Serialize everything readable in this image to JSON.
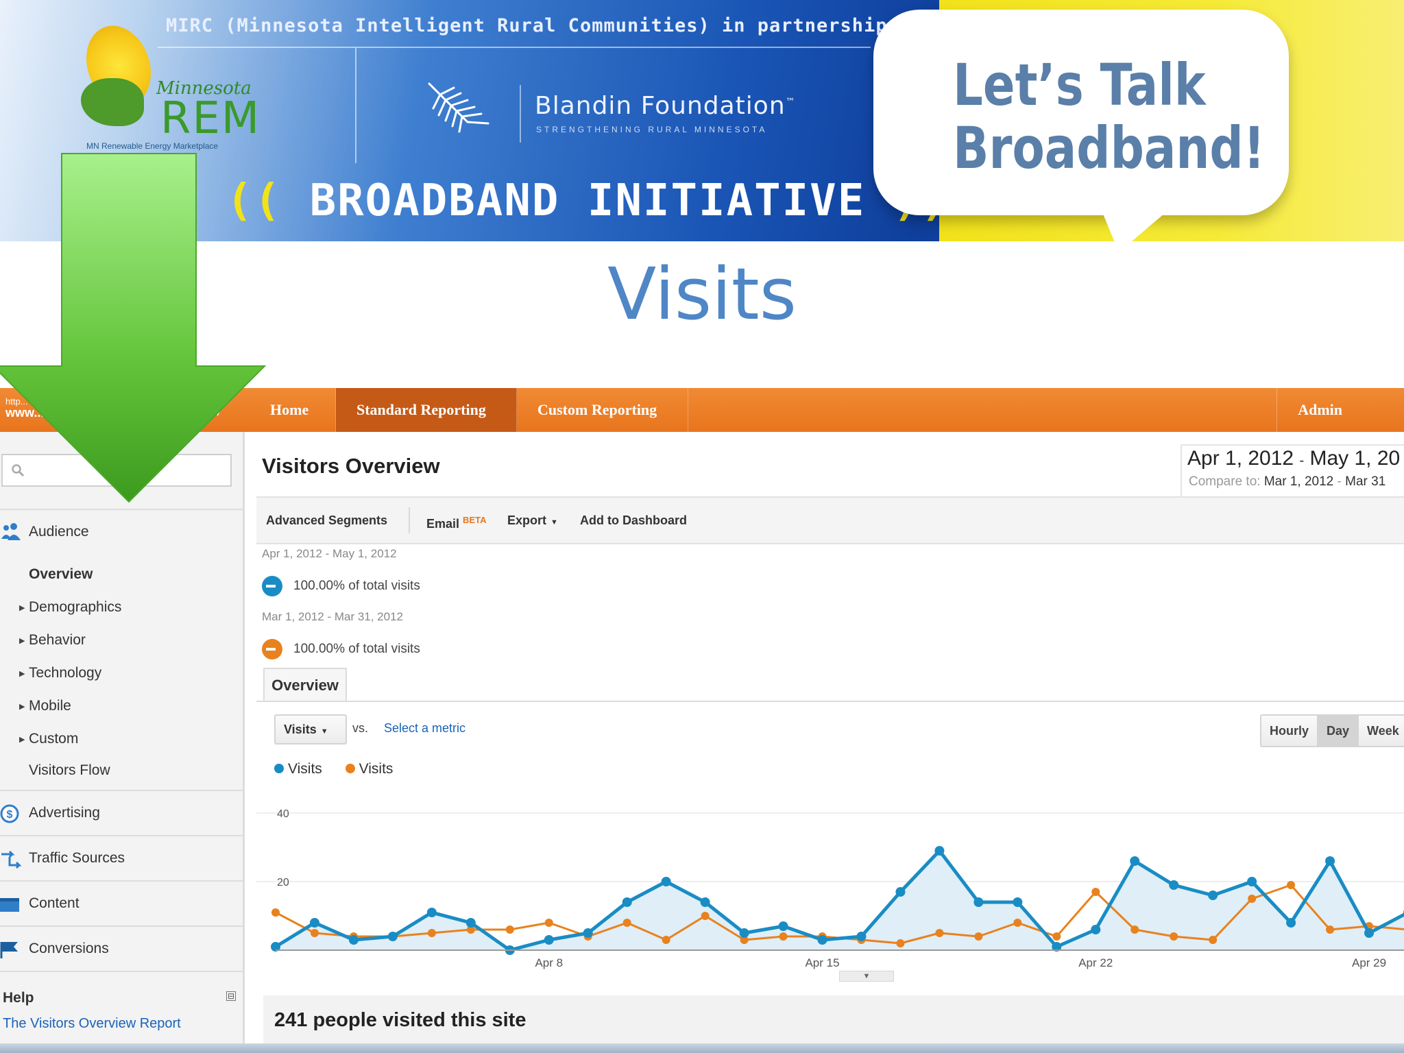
{
  "banner": {
    "partnership_text": "MIRC (Minnesota Intelligent Rural Communities) in partnership with:",
    "rem_logo": {
      "state": "Minnesota",
      "name": "REM",
      "tagline": "MN Renewable Energy Marketplace"
    },
    "blandin": {
      "name": "Blandin Foundation",
      "tm": "™",
      "tagline": "STRENGTHENING RURAL MINNESOTA"
    },
    "initiative": "BROADBAND INITIATIVE",
    "bubble_line1": "Let’s Talk",
    "bubble_line2": "Broadband!",
    "colors": {
      "blue": "#1a55b5",
      "yellow": "#f1e21a"
    }
  },
  "slide_title": "Visits",
  "nav": {
    "account_url_line1": "http...",
    "account_url_line2": "www...",
    "tabs": [
      "Home",
      "Standard Reporting",
      "Custom Reporting"
    ],
    "active_tab": "Standard Reporting",
    "admin": "Admin",
    "accent_color": "#e8751e"
  },
  "sidebar": {
    "search_placeholder": "",
    "audience": "Audience",
    "audience_items": [
      "Overview",
      "Demographics",
      "Behavior",
      "Technology",
      "Mobile",
      "Custom",
      "Visitors Flow"
    ],
    "sections": [
      "Advertising",
      "Traffic Sources",
      "Content",
      "Conversions"
    ],
    "help_heading": "Help",
    "help_collapse": "⊟",
    "help_link": "The Visitors Overview Report"
  },
  "main": {
    "report_title": "Visitors Overview",
    "date_range": {
      "start": "Apr 1, 2012",
      "sep": "-",
      "end": "May 1, 20"
    },
    "compare": {
      "label": "Compare to:",
      "start": "Mar 1, 2012",
      "sep": "-",
      "end": "Mar 31"
    },
    "toolbar": {
      "advanced_segments": "Advanced Segments",
      "email": "Email",
      "beta": "BETA",
      "export": "Export",
      "add_to_dashboard": "Add to Dashboard"
    },
    "segments": [
      {
        "range": "Apr 1, 2012 - May 1, 2012",
        "share": "100.00% of total visits",
        "color": "#1a8cc4"
      },
      {
        "range": "Mar 1, 2012 - Mar 31, 2012",
        "share": "100.00% of total visits",
        "color": "#e8821e"
      }
    ],
    "overview_tab": "Overview",
    "metric": "Visits",
    "vs": "vs.",
    "select_metric": "Select a metric",
    "granularity": [
      "Hourly",
      "Day",
      "Week"
    ],
    "granularity_selected": "Day",
    "summary": "241 people visited this site"
  },
  "chart_data": {
    "type": "line",
    "title": "",
    "xlabel": "",
    "ylabel": "",
    "ylim": [
      0,
      40
    ],
    "yticks": [
      20,
      40
    ],
    "xtick_labels": [
      "Apr 8",
      "Apr 15",
      "Apr 22",
      "Apr 29"
    ],
    "xtick_index": [
      7,
      14,
      21,
      28
    ],
    "grid": true,
    "legend_position": "top-left",
    "series": [
      {
        "name": "Visits",
        "color": "#1a8cc4",
        "filled": true,
        "values": [
          1,
          8,
          3,
          4,
          11,
          8,
          0,
          3,
          5,
          14,
          20,
          14,
          5,
          7,
          3,
          4,
          17,
          29,
          14,
          14,
          1,
          6,
          26,
          19,
          16,
          20,
          8,
          26,
          5,
          11
        ]
      },
      {
        "name": "Visits",
        "color": "#e8821e",
        "filled": false,
        "values": [
          11,
          5,
          4,
          4,
          5,
          6,
          6,
          8,
          4,
          8,
          3,
          10,
          3,
          4,
          4,
          3,
          2,
          5,
          4,
          8,
          4,
          17,
          6,
          4,
          3,
          15,
          19,
          6,
          7,
          6
        ]
      }
    ]
  }
}
